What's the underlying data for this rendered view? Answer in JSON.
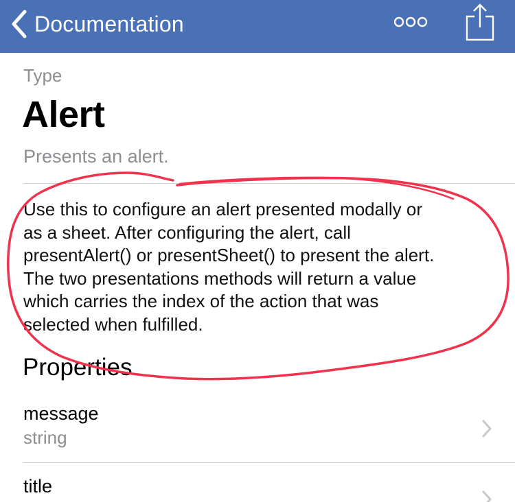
{
  "navbar": {
    "back_label": "Documentation",
    "background": "#4a70b5",
    "icons": [
      "chevron-left-icon",
      "more-icon",
      "share-icon"
    ]
  },
  "doc": {
    "kind_label": "Type",
    "title": "Alert",
    "summary": "Presents an alert.",
    "description_lines": [
      "Use this to configure an alert presented modally or",
      "as a sheet. After configuring the alert, call",
      "presentAlert() or presentSheet() to present the alert.",
      "The two presentations methods will return a value",
      "which carries the index of the action that was",
      "selected when fulfilled."
    ]
  },
  "properties": {
    "header": "Properties",
    "items": [
      {
        "name": "message",
        "type": "string"
      },
      {
        "name": "title",
        "type": ""
      }
    ]
  },
  "annotation": {
    "color": "#f0334d"
  }
}
